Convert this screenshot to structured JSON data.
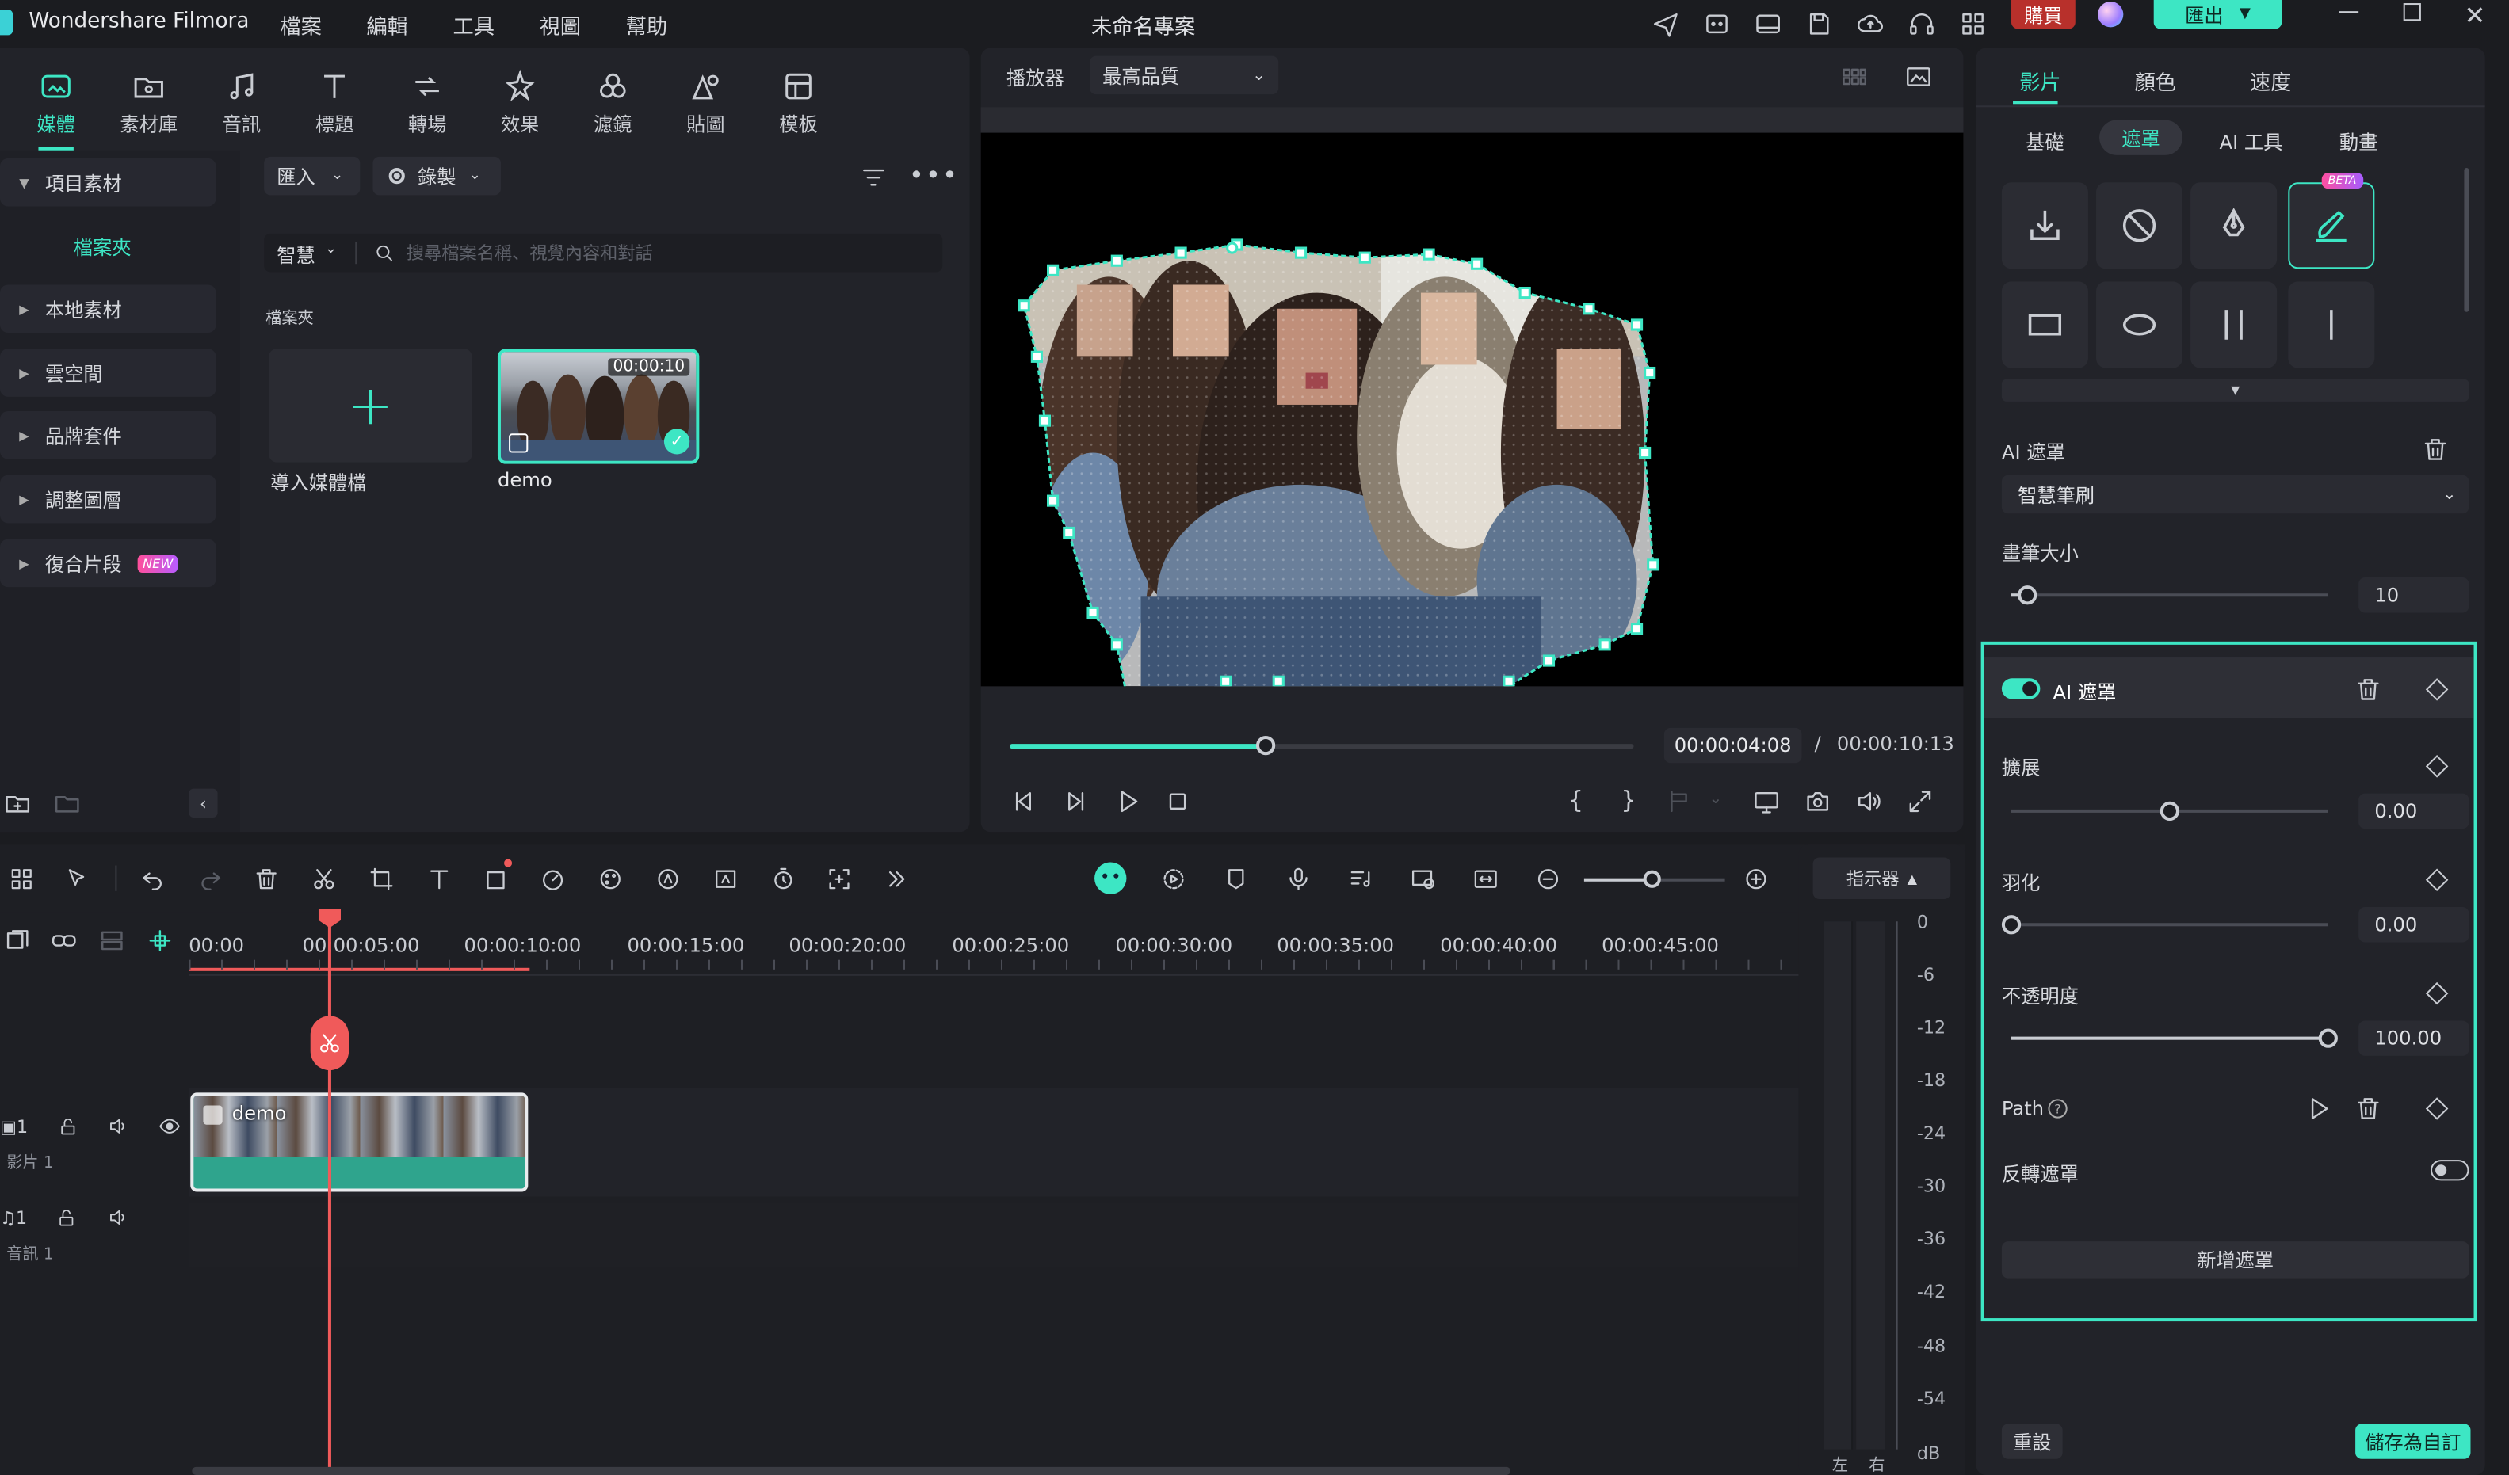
{
  "app": {
    "name": "Wondershare Filmora",
    "project_title": "未命名專案",
    "menu": [
      "檔案",
      "編輯",
      "工具",
      "視圖",
      "幫助"
    ],
    "buy_label": "購買",
    "export_label": "匯出"
  },
  "top_toolbar": {
    "items": [
      {
        "label": "媒體",
        "icon": "media-icon",
        "active": true
      },
      {
        "label": "素材庫",
        "icon": "stock-icon"
      },
      {
        "label": "音訊",
        "icon": "music-icon"
      },
      {
        "label": "標題",
        "icon": "title-icon"
      },
      {
        "label": "轉場",
        "icon": "transition-icon"
      },
      {
        "label": "效果",
        "icon": "effect-icon"
      },
      {
        "label": "濾鏡",
        "icon": "filter-icon"
      },
      {
        "label": "貼圖",
        "icon": "sticker-icon"
      },
      {
        "label": "模板",
        "icon": "template-icon"
      }
    ]
  },
  "sidebar": {
    "items": [
      {
        "label": "項目素材",
        "expanded": true
      },
      {
        "label": "檔案夾",
        "selected": true
      },
      {
        "label": "本地素材"
      },
      {
        "label": "雲空間"
      },
      {
        "label": "品牌套件"
      },
      {
        "label": "調整圖層"
      },
      {
        "label": "復合片段",
        "badge": "NEW"
      }
    ]
  },
  "media": {
    "import_label": "匯入",
    "record_label": "錄製",
    "smart_label": "智慧",
    "search_placeholder": "搜尋檔案名稱、視覺內容和對話",
    "folder_label": "檔案夾",
    "import_tile_label": "導入媒體檔",
    "clip_name": "demo",
    "clip_duration": "00:00:10"
  },
  "player": {
    "label": "播放器",
    "quality": "最高品質",
    "current_time": "00:00:04:08",
    "separator": "/",
    "total_time": "00:00:10:13",
    "progress": 0.41
  },
  "right_panel": {
    "tabs": [
      "影片",
      "顏色",
      "速度"
    ],
    "subtabs": [
      "基礎",
      "遮罩",
      "AI 工具",
      "動畫"
    ],
    "beta_badge": "BETA",
    "ai_mask_title": "AI 遮罩",
    "mode": "智慧筆刷",
    "brush_size_label": "畫筆大小",
    "brush_size_value": "10",
    "brush_size_fraction": 0.05,
    "section_title": "AI 遮罩",
    "expand_label": "擴展",
    "expand_value": "0.00",
    "expand_fraction": 0.5,
    "feather_label": "羽化",
    "feather_value": "0.00",
    "feather_fraction": 0.0,
    "opacity_label": "不透明度",
    "opacity_value": "100.00",
    "opacity_fraction": 1.0,
    "path_label": "Path",
    "invert_label": "反轉遮罩",
    "add_mask_label": "新增遮罩",
    "reset_label": "重設",
    "save_custom_label": "儲存為自訂"
  },
  "timeline": {
    "ruler": [
      "00:00",
      "00:00:05:00",
      "00:00:10:00",
      "00:00:15:00",
      "00:00:20:00",
      "00:00:25:00",
      "00:00:30:00",
      "00:00:35:00",
      "00:00:40:00",
      "00:00:45:00"
    ],
    "video_track_label": "影片 1",
    "audio_track_label": "音訊 1",
    "track_index_video": "1",
    "track_index_audio": "1",
    "clip_label": "demo",
    "meter_title": "指示器",
    "meter_scale": [
      "0",
      "-6",
      "-12",
      "-18",
      "-24",
      "-30",
      "-36",
      "-42",
      "-48",
      "-54",
      "dB"
    ],
    "meter_left": "左",
    "meter_right": "右"
  },
  "colors": {
    "accent": "#3de6c4",
    "playhead": "#f05a5a",
    "buy": "#c0392b",
    "panel": "#222329"
  }
}
